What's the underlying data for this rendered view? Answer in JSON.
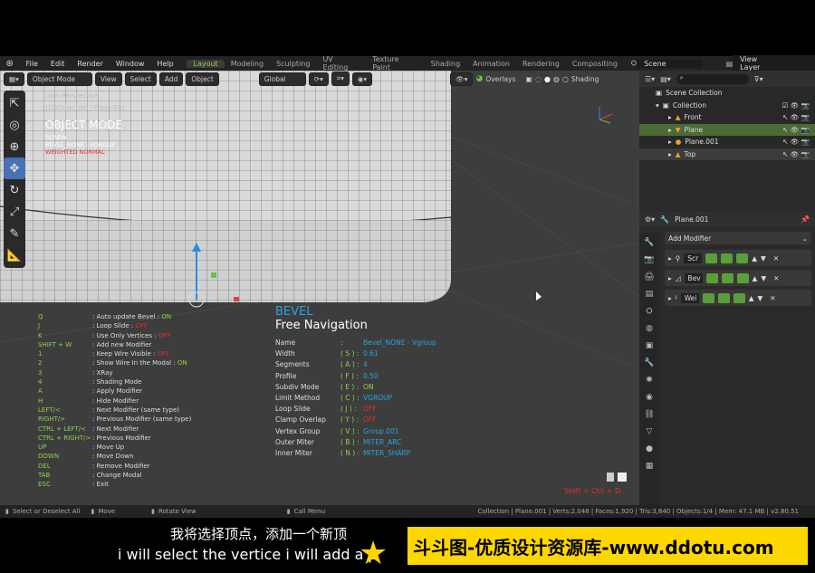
{
  "menu": {
    "items": [
      "File",
      "Edit",
      "Render",
      "Window",
      "Help"
    ],
    "workspaces": [
      "Layout",
      "Modeling",
      "Sculpting",
      "UV Editing",
      "Texture Paint",
      "Shading",
      "Animation",
      "Rendering",
      "Compositing"
    ],
    "active_workspace": "Layout",
    "scene": "Scene",
    "view_layer": "View Layer"
  },
  "viewport_header": {
    "mode": "Object Mode",
    "view": "View",
    "select": "Select",
    "add": "Add",
    "object": "Object",
    "orientation": "Global",
    "overlays": "Overlays",
    "shading": "Shading"
  },
  "viewport_info": {
    "perspective": "User Perspective",
    "collection": "(1) Collection | Plane.001",
    "mode_title": "OBJECT MODE",
    "modifiers": [
      "SCREW",
      "BEVEL_NONE - VGROUP",
      "WEIGHTED NORMAL"
    ]
  },
  "shortcuts": [
    {
      "key": "Q",
      "desc": ": Auto update Bevel : ",
      "state": "ON",
      "state_color": "on"
    },
    {
      "key": "J",
      "desc": ": Loop Slide : ",
      "state": "OFF",
      "state_color": "off"
    },
    {
      "key": "K",
      "desc": ": Use Only Vertices : ",
      "state": "OFF",
      "state_color": "off"
    },
    {
      "key": "SHIFT + W",
      "desc": ": Add new Modifier",
      "state": "",
      "state_color": "on"
    },
    {
      "key": "1",
      "desc": ": Keep Wire Visible : ",
      "state": "OFF",
      "state_color": "off"
    },
    {
      "key": "2",
      "desc": ": Show Wire In the Modal : ",
      "state": "ON",
      "state_color": "on"
    },
    {
      "key": "3",
      "desc": ": XRay",
      "state": "",
      "state_color": "on"
    },
    {
      "key": "4",
      "desc": ": Shading Mode",
      "state": "",
      "state_color": "on"
    },
    {
      "key": "A",
      "desc": ": Apply Modifier",
      "state": "",
      "state_color": "on"
    },
    {
      "key": "H",
      "desc": ": Hide Modifier",
      "state": "",
      "state_color": "on"
    },
    {
      "key": "LEFT/<",
      "desc": ": Next Modifier (same type)",
      "state": "",
      "state_color": "on"
    },
    {
      "key": "RIGHT/>",
      "desc": ": Previous Modifier (same type)",
      "state": "",
      "state_color": "on"
    },
    {
      "key": "CTRL + LEFT/<",
      "desc": ": Next Modifier",
      "state": "",
      "state_color": "on"
    },
    {
      "key": "CTRL + RIGHT/>",
      "desc": ": Previous Modifier",
      "state": "",
      "state_color": "on"
    },
    {
      "key": "UP",
      "desc": ": Move Up",
      "state": "",
      "state_color": "on"
    },
    {
      "key": "DOWN",
      "desc": ": Move Down",
      "state": "",
      "state_color": "on"
    },
    {
      "key": "DEL",
      "desc": ": Remove Modifier",
      "state": "",
      "state_color": "on"
    },
    {
      "key": "TAB",
      "desc": ": Change Modal",
      "state": "",
      "state_color": "on"
    },
    {
      "key": "ESC",
      "desc": ": Exit",
      "state": "",
      "state_color": "on"
    }
  ],
  "bevel": {
    "title": "BEVEL",
    "subtitle": "Free Navigation",
    "rows": [
      {
        "name": "Name",
        "key": ":",
        "value": "Bevel_NONE - Vgroup",
        "color": "blue"
      },
      {
        "name": "Width",
        "key": "( S ) :",
        "value": "0.61",
        "color": "blue"
      },
      {
        "name": "Segments",
        "key": "( A ) :",
        "value": "4",
        "color": "blue"
      },
      {
        "name": "Profile",
        "key": "( F ) :",
        "value": "0.50",
        "color": "blue"
      },
      {
        "name": "Subdiv Mode",
        "key": "( E ) :",
        "value": "ON",
        "color": "green"
      },
      {
        "name": "Limit Method",
        "key": "( C ) :",
        "value": "VGROUP",
        "color": "blue"
      },
      {
        "name": "Loop Slide",
        "key": "( J ) :",
        "value": "OFF",
        "color": "red"
      },
      {
        "name": "Clamp Overlap",
        "key": "( Y ) :",
        "value": "OFF",
        "color": "red"
      },
      {
        "name": "Vertex Group",
        "key": "( V ) :",
        "value": "Group.001",
        "color": "blue"
      },
      {
        "name": "Outer Miter",
        "key": "( B ) :",
        "value": "MITER_ARC",
        "color": "blue"
      },
      {
        "name": "Inner Miter",
        "key": "( N ) :",
        "value": "MITER_SHARP",
        "color": "blue"
      }
    ],
    "hotkey_hint": "Shift + Ctrl + D"
  },
  "outliner": {
    "scene_collection": "Scene Collection",
    "collection": "Collection",
    "objects": [
      "Front",
      "Plane",
      "Plane.001",
      "Top"
    ]
  },
  "properties": {
    "object_name": "Plane.001",
    "add_modifier": "Add Modifier",
    "modifiers": [
      "Scr",
      "Bev",
      "Wei"
    ]
  },
  "statusbar": {
    "select": "Select or Deselect All",
    "move": "Move",
    "rotate": "Rotate View",
    "menu": "Call Menu",
    "stats": "Collection | Plane.001 | Verts:2,048 | Faces:1,920 | Tris:3,840 | Objects:1/4 | Mem: 47.1 MB | v2.80.51"
  },
  "subtitles": {
    "chinese": "我将选择顶点，添加一个新顶",
    "english": "i will select the vertice i will add a p",
    "watermark": "斗斗图-优质设计资源库-www.ddotu.com"
  },
  "colors": {
    "accent_green": "#8fd14f",
    "accent_blue": "#29a3db",
    "off_red": "#e03030",
    "active_tool": "#4772b3",
    "watermark_bg": "#ffd700"
  }
}
